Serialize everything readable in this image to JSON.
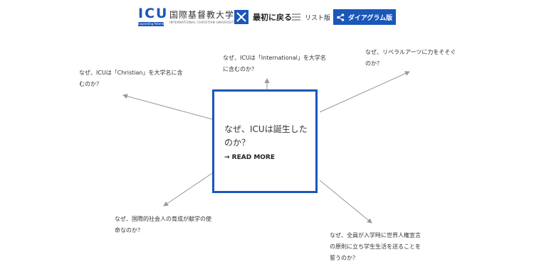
{
  "header": {
    "logo": {
      "wordmark": "ICU",
      "tagline": "Expanding Potential",
      "name_jp": "国際基督教大学",
      "name_en": "INTERNATIONAL CHRISTIAN UNIVERSITY"
    },
    "back_to_first_label": "最初に戻る",
    "list_view_label": "リスト版",
    "diagram_view_label": "ダイアグラム版"
  },
  "center": {
    "title": "なぜ、ICUは誕生したのか？",
    "read_more": "→ READ MORE"
  },
  "questions": [
    {
      "id": "international",
      "text": "なぜ、ICUは「International」を大学名に含むのか？"
    },
    {
      "id": "christian",
      "text": "なぜ、ICUは「Christian」を大学名に含むのか？"
    },
    {
      "id": "liberal",
      "text": "なぜ、リベラルアーツに力をそそぐのか？"
    },
    {
      "id": "society",
      "text": "なぜ、国際的社会人の育成が献学の使命なのか？"
    },
    {
      "id": "oath",
      "text": "なぜ、全員が入学時に世界人権宣言の原則に立ち学生生活を送ることを誓うのか？"
    }
  ],
  "colors": {
    "accent": "#1a57b8",
    "line": "#999999",
    "text": "#333333"
  }
}
